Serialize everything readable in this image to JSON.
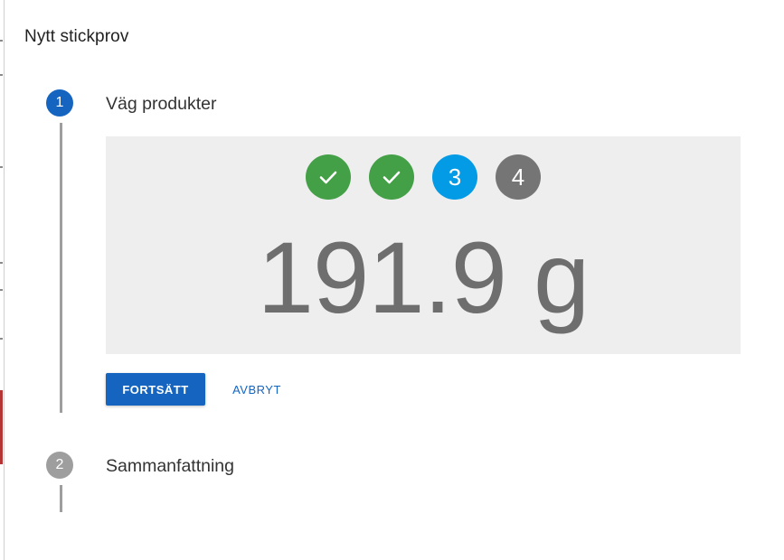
{
  "dialog": {
    "title": "Nytt stickprov"
  },
  "steps": [
    {
      "number": "1",
      "label": "Väg produkter",
      "state": "active"
    },
    {
      "number": "2",
      "label": "Sammanfattning",
      "state": "inactive"
    }
  ],
  "weighing": {
    "progress": [
      {
        "state": "done",
        "icon": "check-icon",
        "label": ""
      },
      {
        "state": "done",
        "icon": "check-icon",
        "label": ""
      },
      {
        "state": "current",
        "icon": "",
        "label": "3"
      },
      {
        "state": "pending",
        "icon": "",
        "label": "4"
      }
    ],
    "weight_display": "191.9 g"
  },
  "actions": {
    "continue_label": "FORTSÄTT",
    "cancel_label": "AVBRYT"
  },
  "colors": {
    "primary": "#1565c0",
    "done": "#43a047",
    "current": "#039be5",
    "pending": "#757575",
    "inactive_step": "#9e9e9e",
    "panel_bg": "#eeeeee"
  }
}
